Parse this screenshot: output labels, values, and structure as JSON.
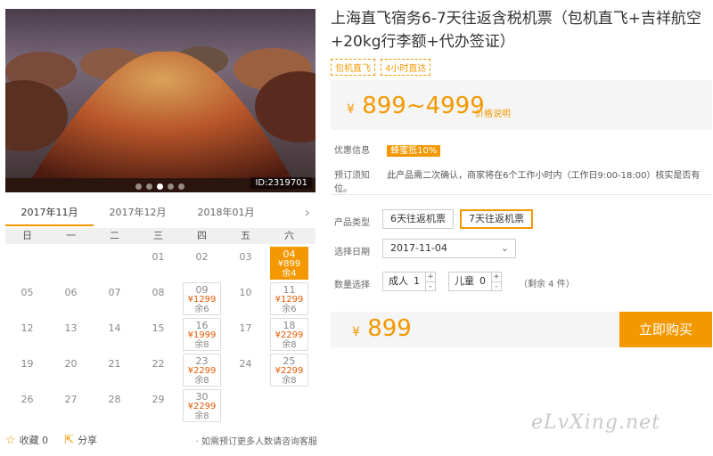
{
  "hero": {
    "image_id": "ID:2319701",
    "slides": 5,
    "active_slide": 3
  },
  "calendar": {
    "months": [
      "2017年11月",
      "2017年12月",
      "2018年01月"
    ],
    "active_month": 0,
    "weekdays": [
      "日",
      "一",
      "二",
      "三",
      "四",
      "五",
      "六"
    ],
    "rows": [
      [
        {
          "d": ""
        },
        {
          "d": ""
        },
        {
          "d": ""
        },
        {
          "d": "01"
        },
        {
          "d": "02"
        },
        {
          "d": "03"
        },
        {
          "d": "04",
          "p": "¥899",
          "r": "余4",
          "sel": true
        }
      ],
      [
        {
          "d": "05"
        },
        {
          "d": "06"
        },
        {
          "d": "07"
        },
        {
          "d": "08"
        },
        {
          "d": "09",
          "p": "¥1299",
          "r": "余6"
        },
        {
          "d": "10"
        },
        {
          "d": "11",
          "p": "¥1299",
          "r": "余6"
        }
      ],
      [
        {
          "d": "12"
        },
        {
          "d": "13"
        },
        {
          "d": "14"
        },
        {
          "d": "15"
        },
        {
          "d": "16",
          "p": "¥1999",
          "r": "余8"
        },
        {
          "d": "17"
        },
        {
          "d": "18",
          "p": "¥2299",
          "r": "余8"
        }
      ],
      [
        {
          "d": "19"
        },
        {
          "d": "20"
        },
        {
          "d": "21"
        },
        {
          "d": "22"
        },
        {
          "d": "23",
          "p": "¥2299",
          "r": "余8"
        },
        {
          "d": "24"
        },
        {
          "d": "25",
          "p": "¥2299",
          "r": "余8"
        }
      ],
      [
        {
          "d": "26"
        },
        {
          "d": "27"
        },
        {
          "d": "28"
        },
        {
          "d": "29"
        },
        {
          "d": "30",
          "p": "¥2299",
          "r": "余8"
        },
        {
          "d": ""
        },
        {
          "d": ""
        }
      ]
    ]
  },
  "social": {
    "fav_label": "收藏 0",
    "share_label": "分享",
    "note": "· 如需预订更多人数请咨询客服"
  },
  "product": {
    "title": "上海直飞宿务6-7天往返含税机票（包机直飞+吉祥航空+20kg行李额+代办签证）",
    "tags": [
      "包机直飞",
      "4小时直达"
    ],
    "currency": "¥",
    "price_range": "899~4999",
    "price_explain": "价格说明"
  },
  "info": {
    "promo_label": "优惠信息",
    "promo_badge": "蜂蜜抵10%",
    "notice_label": "预订须知",
    "notice_text": "此产品需二次确认，商家将在6个工作小时内（工作日9:00-18:00）核实是否有位。"
  },
  "options": {
    "type_label": "产品类型",
    "types": [
      "6天往返机票",
      "7天往返机票"
    ],
    "selected_type": 1,
    "date_label": "选择日期",
    "date_value": "2017-11-04",
    "qty_label": "数量选择",
    "adult_label": "成人",
    "adult_value": "1",
    "child_label": "儿童",
    "child_value": "0",
    "stock": "（剩余 4 件）"
  },
  "buy": {
    "currency": "¥",
    "price": "899",
    "button": "立即购买"
  },
  "watermark": "eLvXing.net",
  "colors": {
    "accent": "#f39800",
    "price": "#e65a00"
  }
}
